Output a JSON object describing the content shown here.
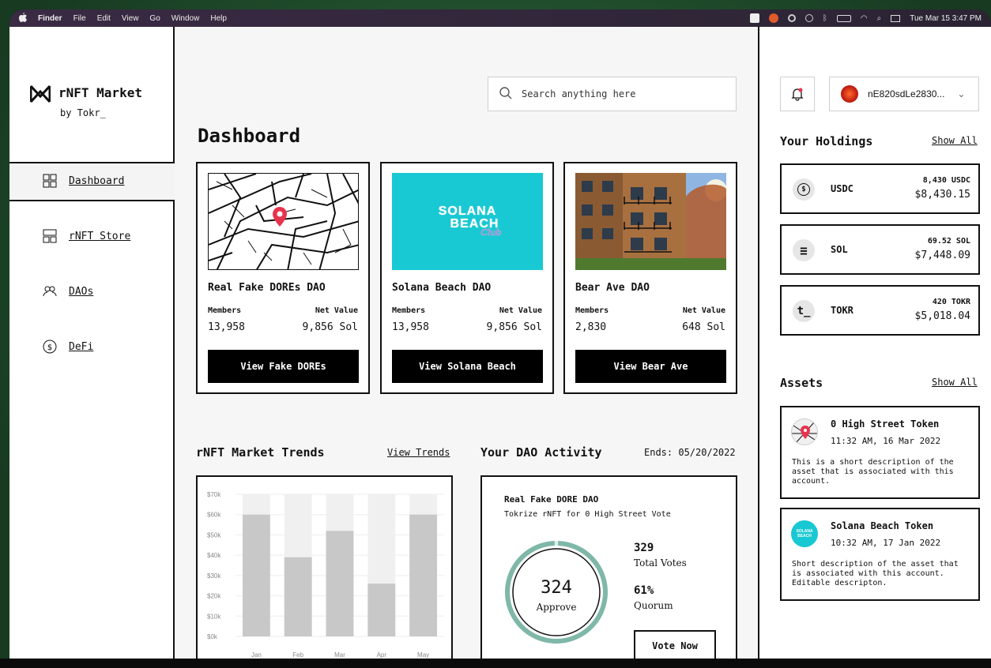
{
  "menubar": {
    "apple": "",
    "items": [
      "Finder",
      "File",
      "Edit",
      "View",
      "Go",
      "Window",
      "Help"
    ],
    "clock": "Tue Mar 15  3:47 PM"
  },
  "sidebar": {
    "brand_name": "rNFT Market",
    "brand_sub": "by Tokr_",
    "items": [
      {
        "label": "Dashboard",
        "icon": "grid-icon"
      },
      {
        "label": "rNFT Store",
        "icon": "store-icon"
      },
      {
        "label": "DAOs",
        "icon": "people-icon"
      },
      {
        "label": "DeFi",
        "icon": "dollar-circle-icon"
      }
    ]
  },
  "search": {
    "placeholder": "Search anything here"
  },
  "main": {
    "title": "Dashboard",
    "cards": [
      {
        "name": "Real Fake DOREs DAO",
        "members_label": "Members",
        "value_label": "Net Value",
        "members": "13,958",
        "value": "9,856 Sol",
        "button": "View Fake DOREs"
      },
      {
        "name": "Solana Beach DAO",
        "members_label": "Members",
        "value_label": "Net Value",
        "members": "13,958",
        "value": "9,856 Sol",
        "button": "View Solana Beach",
        "logo_line1": "SOLANA",
        "logo_line2": "BEACH",
        "logo_script": "Club"
      },
      {
        "name": "Bear Ave DAO",
        "members_label": "Members",
        "value_label": "Net Value",
        "members": "2,830",
        "value": "648 Sol",
        "button": "View Bear Ave"
      }
    ],
    "trends_title": "rNFT Market Trends",
    "trends_link": "View Trends",
    "dao_title": "Your DAO Activity",
    "dao_ends": "Ends: 05/20/2022",
    "dao": {
      "name": "Real Fake DORE DAO",
      "subtitle": "Tokrize rNFT for 0 High Street Vote",
      "approve_count": "324",
      "approve_label": "Approve",
      "total_votes": "329",
      "total_label": "Total Votes",
      "quorum": "61%",
      "quorum_label": "Quorum",
      "vote_button": "Vote Now"
    }
  },
  "chart_data": {
    "type": "bar",
    "categories": [
      "Jan",
      "Feb",
      "Mar",
      "Apr",
      "May"
    ],
    "values": [
      60000,
      39000,
      52000,
      26000,
      60000
    ],
    "y_ticks": [
      "$0k",
      "$10k",
      "$20k",
      "$30k",
      "$40k",
      "$50k",
      "$60k",
      "$70k"
    ],
    "ylim": [
      0,
      70000
    ],
    "title": "",
    "xlabel": "",
    "ylabel": "",
    "bar_color": "#c8c8c8",
    "track_color": "#f0f0f0",
    "grid": true
  },
  "right": {
    "wallet": "nE820sdLe2830...",
    "holdings_title": "Your Holdings",
    "holdings_link": "Show All",
    "holdings": [
      {
        "icon": "$",
        "symbol": "USDC",
        "amount": "8,430 USDC",
        "usd": "$8,430.15"
      },
      {
        "icon": "≡",
        "symbol": "SOL",
        "amount": "69.52 SOL",
        "usd": "$7,448.09"
      },
      {
        "icon": "t_",
        "symbol": "TOKR",
        "amount": "420 TOKR",
        "usd": "$5,018.04"
      }
    ],
    "assets_title": "Assets",
    "assets_link": "Show All",
    "assets": [
      {
        "name": "0 High Street Token",
        "time": "11:32 AM, 16 Mar 2022",
        "desc": "This is a short description of the asset that is associated with this account."
      },
      {
        "name": "Solana Beach Token",
        "time": "10:32 AM, 17 Jan 2022",
        "desc": "Short description of the asset that is associated with this account. Editable descripton.",
        "logo": "SOLANA BEACH"
      }
    ]
  }
}
